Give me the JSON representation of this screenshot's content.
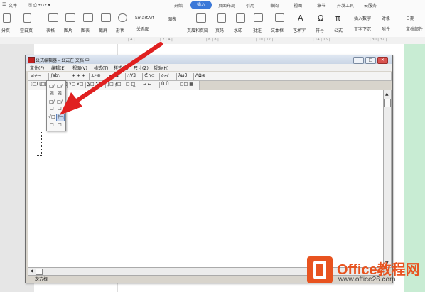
{
  "menubar": {
    "file": "文件",
    "tabs": [
      "开始",
      "插入",
      "页面布局",
      "引用",
      "审阅",
      "视图",
      "章节",
      "开发工具",
      "云服务"
    ],
    "active_tab": "插入"
  },
  "ribbon": {
    "items": [
      "分页",
      "空白页",
      "表格",
      "图片",
      "图表",
      "截屏",
      "形状",
      "SmartArt",
      "关系图",
      "图表",
      "页眉和页脚",
      "页码",
      "水印",
      "批注",
      "文本框",
      "艺术字",
      "符号",
      "公式",
      "插入数字",
      "对象",
      "日期",
      "首字下沉",
      "附件",
      "文档部件"
    ]
  },
  "eq_window": {
    "title": "公式编辑器 - 公式在 文档 中",
    "menu": [
      "文件(F)",
      "编辑(E)",
      "视图(V)",
      "格式(T)",
      "样式(S)",
      "尺寸(Z)",
      "帮助(H)"
    ],
    "toolbar1": [
      "≤≠≈",
      "∫ab∵",
      "∗ ∗ ∗",
      "±•⊗",
      "→⇔↓",
      "∴∀∃",
      "∉∩⊂",
      "∂∞ℓ",
      "λωθ",
      "ΛΩ⊗"
    ],
    "toolbar2": [
      "(□) [□]",
      "□/□ √□",
      "x□ x□",
      "∑□ ∑□",
      "∫□ ∮□",
      "□̄ □̲",
      "→ ←",
      "Ů Ů",
      "□□ ▦"
    ],
    "palette": [
      "□/□",
      "□/□",
      "%",
      "%",
      "□/□",
      "□/□",
      "√□",
      "∛□",
      "□",
      "□"
    ],
    "status": "次方根",
    "win_buttons": [
      "—",
      "□",
      "✕"
    ]
  },
  "watermark": {
    "brand": "Office教程网",
    "url": "www.office26.com"
  }
}
